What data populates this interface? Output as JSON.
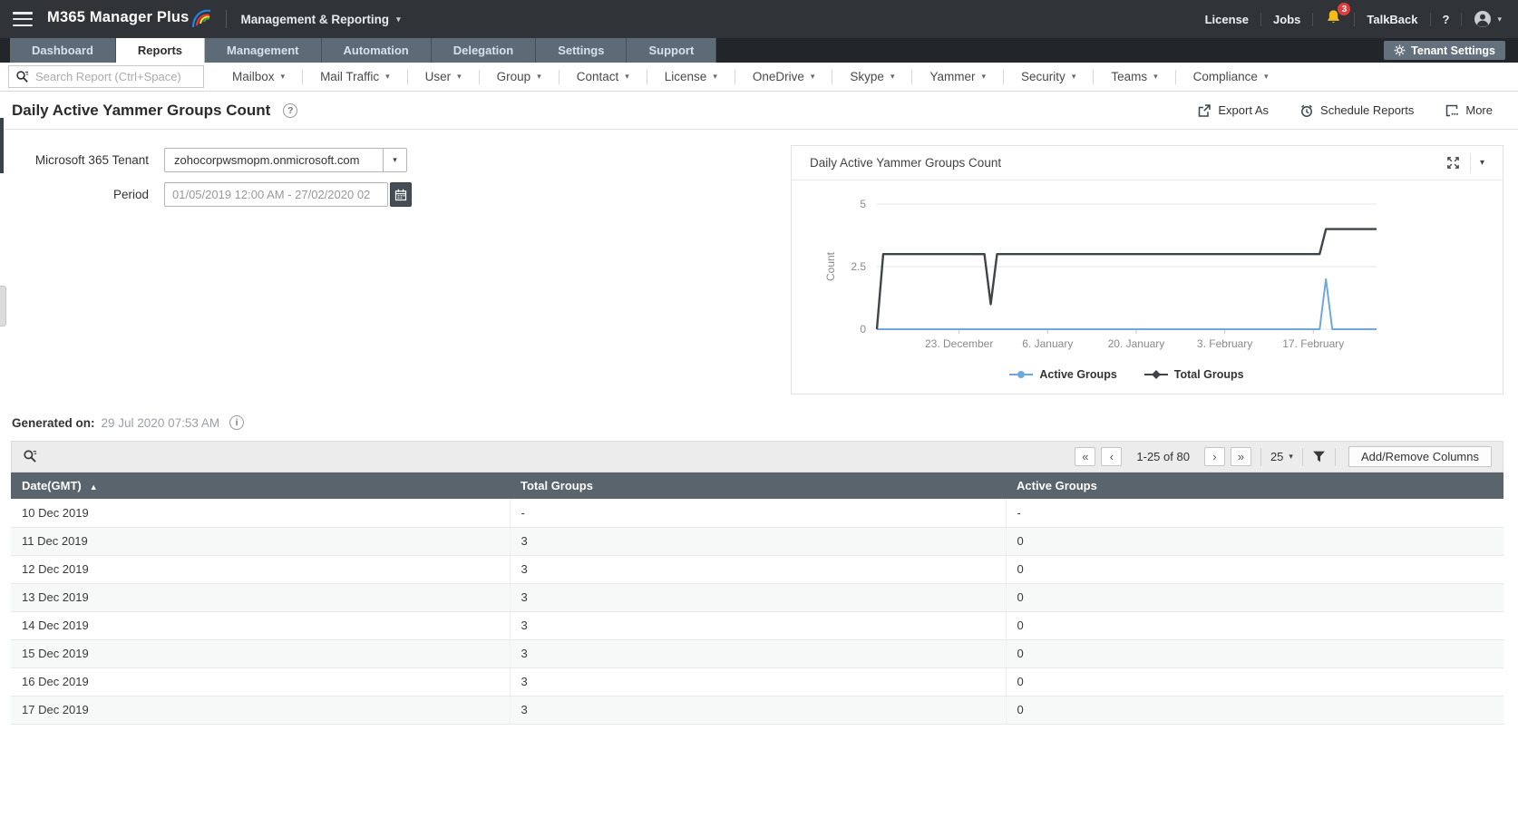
{
  "topbar": {
    "app_name": "M365 Manager Plus",
    "context_menu": "Management & Reporting",
    "right": {
      "license": "License",
      "jobs": "Jobs",
      "notification_count": "3",
      "talkback": "TalkBack",
      "help": "?"
    }
  },
  "tabs": [
    {
      "label": "Dashboard",
      "active": false
    },
    {
      "label": "Reports",
      "active": true
    },
    {
      "label": "Management",
      "active": false
    },
    {
      "label": "Automation",
      "active": false
    },
    {
      "label": "Delegation",
      "active": false
    },
    {
      "label": "Settings",
      "active": false
    },
    {
      "label": "Support",
      "active": false
    }
  ],
  "tenant_settings_button": "Tenant Settings",
  "report_nav": {
    "search_placeholder": "Search Report (Ctrl+Space)",
    "categories": [
      "Mailbox",
      "Mail Traffic",
      "User",
      "Group",
      "Contact",
      "License",
      "OneDrive",
      "Skype",
      "Yammer",
      "Security",
      "Teams",
      "Compliance"
    ]
  },
  "page": {
    "title": "Daily Active Yammer Groups Count",
    "help_glyph": "?",
    "actions": {
      "export": "Export As",
      "schedule": "Schedule Reports",
      "more": "More"
    }
  },
  "filters": {
    "tenant_label": "Microsoft 365 Tenant",
    "tenant_value": "zohocorpwsmopm.onmicrosoft.com",
    "period_label": "Period",
    "period_value": "01/05/2019 12:00 AM - 27/02/2020 02"
  },
  "chart_card": {
    "title": "Daily Active Yammer Groups Count"
  },
  "chart_data": {
    "type": "line",
    "title": "Daily Active Yammer Groups Count",
    "xlabel": "",
    "ylabel": "Count",
    "ylim": [
      0,
      5
    ],
    "yticks": [
      0,
      2.5,
      5
    ],
    "x_unit": "days offset from 10 Dec 2019 (80 daily records through 27 Feb 2020)",
    "x_range": [
      0,
      79
    ],
    "xticks": [
      {
        "x": 13,
        "label": "23. December"
      },
      {
        "x": 27,
        "label": "6. January"
      },
      {
        "x": 41,
        "label": "20. January"
      },
      {
        "x": 55,
        "label": "3. February"
      },
      {
        "x": 69,
        "label": "17. February"
      }
    ],
    "grid": true,
    "legend_position": "bottom",
    "series": [
      {
        "name": "Active Groups",
        "color": "#6fa8e0",
        "stroke_width": 2,
        "points": [
          [
            0,
            0
          ],
          [
            70,
            0
          ],
          [
            71,
            2
          ],
          [
            72,
            0
          ],
          [
            79,
            0
          ]
        ]
      },
      {
        "name": "Total Groups",
        "color": "#3f4448",
        "stroke_width": 2.4,
        "points": [
          [
            0,
            0
          ],
          [
            1,
            3
          ],
          [
            17,
            3
          ],
          [
            18,
            1
          ],
          [
            19,
            3
          ],
          [
            70,
            3
          ],
          [
            71,
            4
          ],
          [
            79,
            4
          ]
        ]
      }
    ]
  },
  "generated": {
    "label": "Generated on:",
    "value": "29 Jul 2020 07:53 AM",
    "info_glyph": "i"
  },
  "table_toolbar": {
    "pagination": {
      "first": "«",
      "prev": "‹",
      "range": "1-25 of 80",
      "next": "›",
      "last": "»",
      "page_size": "25"
    },
    "add_remove_columns": "Add/Remove Columns"
  },
  "table": {
    "columns": [
      "Date(GMT)",
      "Total Groups",
      "Active Groups"
    ],
    "rows": [
      [
        "10 Dec 2019",
        "-",
        "-"
      ],
      [
        "11 Dec 2019",
        "3",
        "0"
      ],
      [
        "12 Dec 2019",
        "3",
        "0"
      ],
      [
        "13 Dec 2019",
        "3",
        "0"
      ],
      [
        "14 Dec 2019",
        "3",
        "0"
      ],
      [
        "15 Dec 2019",
        "3",
        "0"
      ],
      [
        "16 Dec 2019",
        "3",
        "0"
      ],
      [
        "17 Dec 2019",
        "3",
        "0"
      ]
    ]
  }
}
